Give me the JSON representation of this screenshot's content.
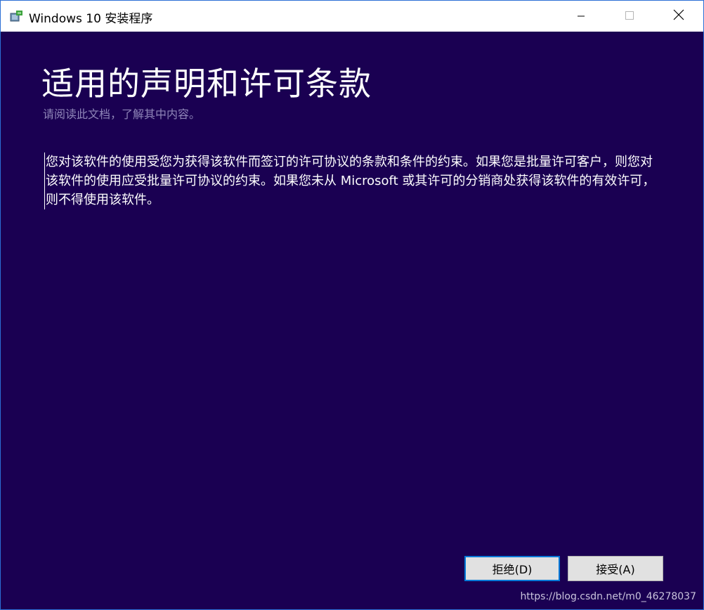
{
  "window": {
    "title": "Windows 10 安装程序",
    "icons": {
      "app": "setup-disc-icon",
      "minimize": "minimize-icon",
      "maximize": "maximize-icon",
      "close": "close-icon"
    }
  },
  "page": {
    "heading": "适用的声明和许可条款",
    "subheading": "请阅读此文档，了解其中内容。",
    "license_text": "您对该软件的使用受您为获得该软件而签订的许可协议的条款和条件的约束。如果您是批量许可客户，则您对该软件的使用应受批量许可协议的约束。如果您未从 Microsoft 或其许可的分销商处获得该软件的有效许可，则不得使用该软件。"
  },
  "buttons": {
    "decline": "拒绝(D)",
    "accept": "接受(A)"
  },
  "watermark": "https://blog.csdn.net/m0_46278037",
  "colors": {
    "background": "#1a0052",
    "titlebar": "#ffffff",
    "accent": "#0078d7",
    "subheading": "#8f86b8"
  }
}
